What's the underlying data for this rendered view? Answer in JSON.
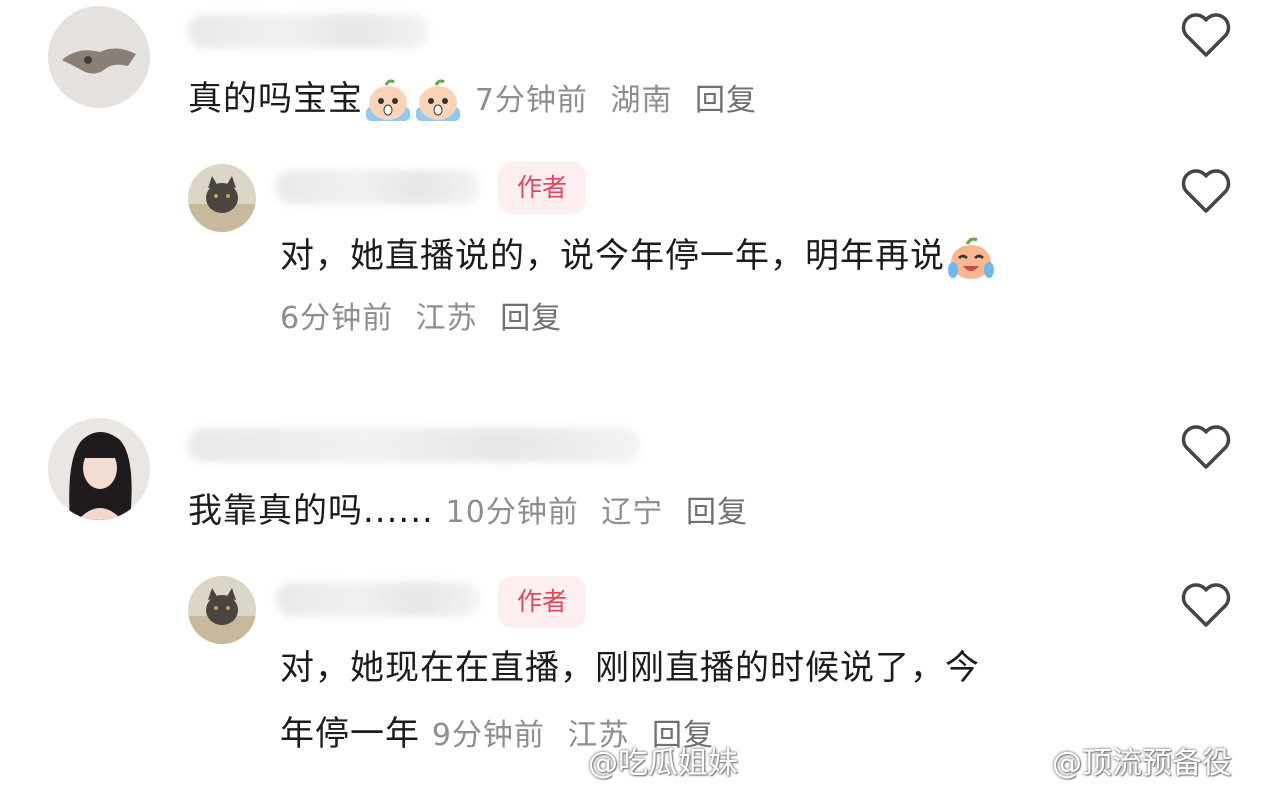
{
  "comments": [
    {
      "text": "真的吗宝宝",
      "time": "7分钟前",
      "location": "湖南",
      "reply": "回复",
      "emoji_count": 2,
      "emoji": "crying-peach-emoji"
    },
    {
      "badge": "作者",
      "text": "对，她直播说的，说今年停一年，明年再说",
      "time": "6分钟前",
      "location": "江苏",
      "reply": "回复",
      "emoji": "laugh-cry-peach-emoji"
    },
    {
      "text": "我靠真的吗......",
      "time": "10分钟前",
      "location": "辽宁",
      "reply": "回复"
    },
    {
      "badge": "作者",
      "text_line1": "对，她现在在直播，刚刚直播的时候说了，今",
      "text_line2": "年停一年",
      "time": "9分钟前",
      "location": "江苏",
      "reply": "回复"
    }
  ],
  "watermarks": [
    {
      "text": "@吃瓜姐妹"
    },
    {
      "text": "@顶流预备役"
    }
  ],
  "icons": {
    "heart": "heart-outline-icon",
    "weibo": "weibo-logo-icon"
  }
}
